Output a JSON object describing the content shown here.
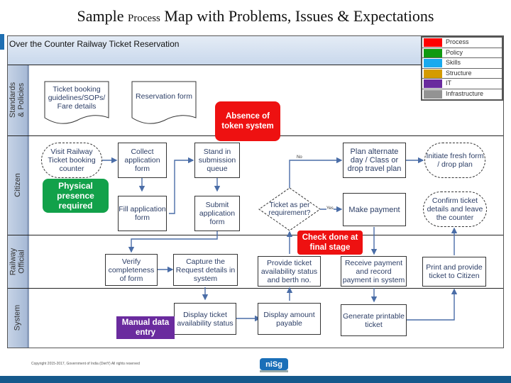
{
  "title": {
    "part1": "Sample ",
    "part2": "Process",
    "part3": " Map with Problems, Issues & Expectations"
  },
  "header": {
    "text": "Over the Counter Railway Ticket Reservation"
  },
  "legend": [
    {
      "label": "Process",
      "color": "#ff0000"
    },
    {
      "label": "Policy",
      "color": "#109a10"
    },
    {
      "label": "Skills",
      "color": "#19aaee"
    },
    {
      "label": "Structure",
      "color": "#d49b00"
    },
    {
      "label": "IT",
      "color": "#6a2b9e"
    },
    {
      "label": "Infrastructure",
      "color": "#939393"
    }
  ],
  "lanes": {
    "standards": "Standards & Policies",
    "citizen": "Citizen",
    "official": "Railway Official",
    "system": "System"
  },
  "documents": {
    "guidelines": "Ticket booking guidelines/SOPs/ Fare details",
    "reservation_form": "Reservation form"
  },
  "nodes": {
    "visit": "Visit Railway Ticket booking counter",
    "collect": "Collect application form",
    "stand": "Stand in submission queue",
    "fill": "Fill application form",
    "submit": "Submit application form",
    "decision": "Ticket as per requirement?",
    "plan_alt": "Plan alternate day / Class or drop travel plan",
    "initiate": "Initiate fresh form / drop plan",
    "make_payment": "Make payment",
    "confirm": "Confirm ticket details and leave the counter",
    "verify": "Verify completeness of form",
    "capture": "Capture the Request details in system",
    "provide": "Provide ticket availability status and berth no.",
    "receive": "Receive payment and record payment in system",
    "print": "Print and provide ticket to Citizen",
    "display_avail": "Display ticket availability status",
    "display_amount": "Display amount payable",
    "generate": "Generate printable ticket"
  },
  "edge_labels": {
    "no": "No",
    "yes": "Yes"
  },
  "callouts": {
    "token": {
      "text": "Absence of token system",
      "category": "Process"
    },
    "presence": {
      "text": "Physical presence required",
      "category": "Policy"
    },
    "check": {
      "text": "Check done at final stage",
      "category": "Process"
    },
    "manual": {
      "text": "Manual data entry",
      "category": "IT"
    }
  },
  "footer": {
    "copyright": "Copyright 2015-2017, Government of India (DietY) All rights reserved",
    "logo": "niSg"
  }
}
